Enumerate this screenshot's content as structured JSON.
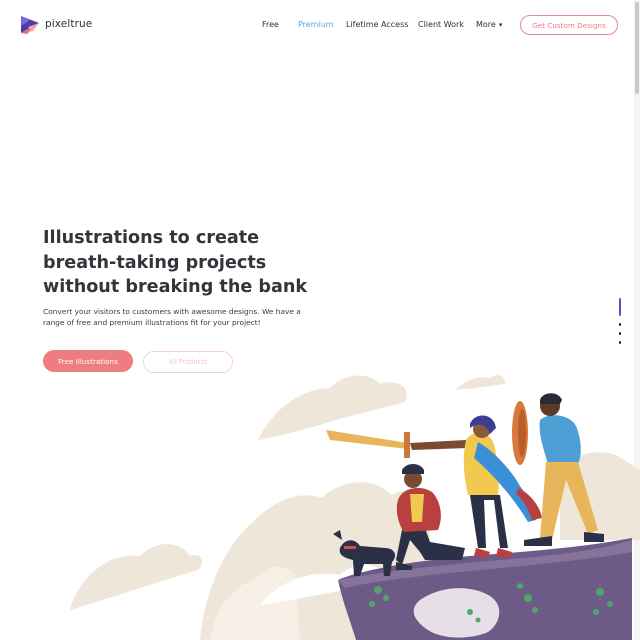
{
  "brand": {
    "name": "pixeltrue",
    "logo_icon": "pixeltrue-logo-icon"
  },
  "nav": {
    "items": [
      {
        "label": "Free",
        "active": false
      },
      {
        "label": "Premium",
        "active": true
      },
      {
        "label": "Lifetime Access",
        "active": false
      },
      {
        "label": "Client Work",
        "active": false
      },
      {
        "label": "More",
        "active": false,
        "icon": "chevron-down-icon"
      }
    ],
    "cta_label": "Get Custom Designs"
  },
  "hero": {
    "title_lines": [
      "Illustrations to create",
      "breath-taking projects",
      "without breaking the bank"
    ],
    "subtitle_lines": [
      "Convert your visitors to customers with awesome designs. We have a",
      "range of free and premium illustrations fit for your project!"
    ],
    "primary_button": "Free Illustrations",
    "secondary_button": "All Products"
  },
  "slider": {
    "slide_count": 4,
    "active_index": 0
  },
  "colors": {
    "accent": "#ee7d82",
    "nav_active": "#5aa3e6",
    "text_dark": "#34343c",
    "cloud": "#efe6da",
    "cliff": "#6d5a86",
    "slider_active": "#5a4de0"
  }
}
